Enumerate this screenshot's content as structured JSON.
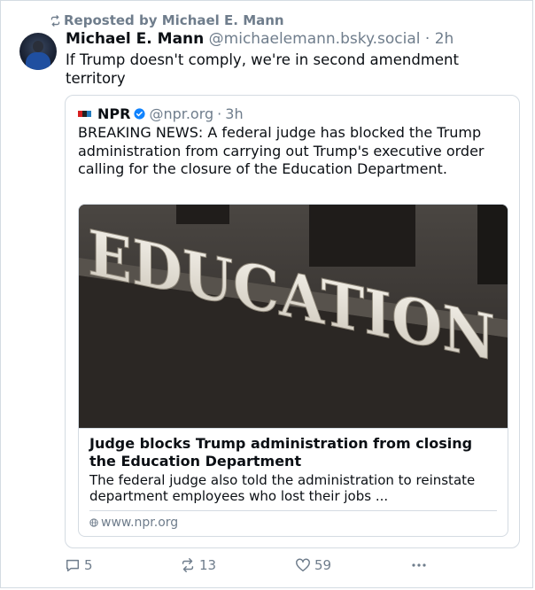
{
  "repost": {
    "label": "Reposted by Michael E. Mann",
    "icon": "repost-icon"
  },
  "post": {
    "author_name": "Michael E. Mann",
    "author_handle": "@michaelemann.bsky.social",
    "separator": "·",
    "time": "2h",
    "text": "If Trump doesn't comply, we're in second amendment territory"
  },
  "quote": {
    "author_name": "NPR",
    "verified_icon": "verified-badge-icon",
    "author_handle": "@npr.org",
    "separator": "·",
    "time": "3h",
    "text": "BREAKING NEWS: A federal judge has blocked the Trump administration from carrying out Trump's executive order calling for the closure of the Education Department.",
    "card": {
      "image_sign_text": "EDUCATION",
      "title": "Judge blocks Trump administration from closing the Education Department",
      "description": "The federal judge also told the administration to reinstate department employees who lost their jobs ...",
      "domain": "www.npr.org",
      "domain_icon": "globe-icon"
    }
  },
  "actions": {
    "replies": "5",
    "reposts": "13",
    "likes": "59",
    "more_icon": "more-dots-icon"
  },
  "colors": {
    "text": "#0b0f14",
    "muted": "#6f7d8c",
    "border": "#d4dbe2",
    "verified": "#1083fe",
    "npr_red": "#d62021",
    "npr_black": "#222222",
    "npr_blue": "#237bbd"
  }
}
